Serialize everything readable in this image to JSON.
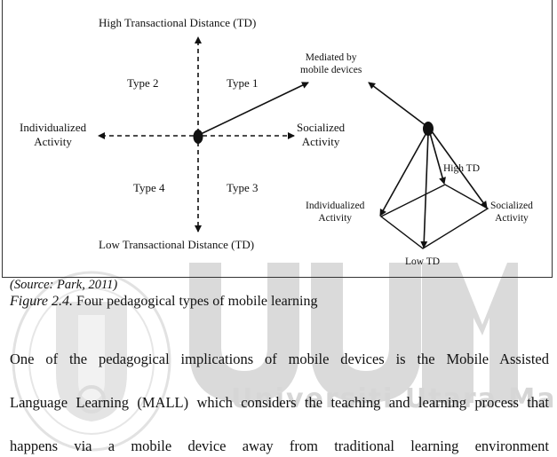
{
  "figure": {
    "axes": {
      "top": "High Transactional Distance (TD)",
      "bottom": "Low Transactional Distance (TD)",
      "left_line1": "Individualized",
      "left_line2": "Activity",
      "right_line1": "Socialized",
      "right_line2": "Activity"
    },
    "quadrants": {
      "type1": "Type 1",
      "type2": "Type 2",
      "type3": "Type 3",
      "type4": "Type 4"
    },
    "mediated_line1": "Mediated by",
    "mediated_line2": "mobile devices",
    "pyramid": {
      "high": "High TD",
      "low": "Low TD",
      "left_line1": "Individualized",
      "left_line2": "Activity",
      "right_line1": "Socialized",
      "right_line2": "Activity"
    }
  },
  "source": "(Source: Park, 2011)",
  "caption": {
    "label": "Figure 2.4.",
    "text": " Four pedagogical types of mobile learning"
  },
  "paragraph": [
    "One of the pedagogical implications of mobile devices is the Mobile Assisted",
    "Language Learning (MALL) which considers the teaching and learning process that",
    "happens via a mobile device away from traditional learning environment"
  ],
  "watermark": {
    "letters": "UUM",
    "subtitle": "Universiti Utara Malaysia",
    "color": "#d9d9d9"
  }
}
